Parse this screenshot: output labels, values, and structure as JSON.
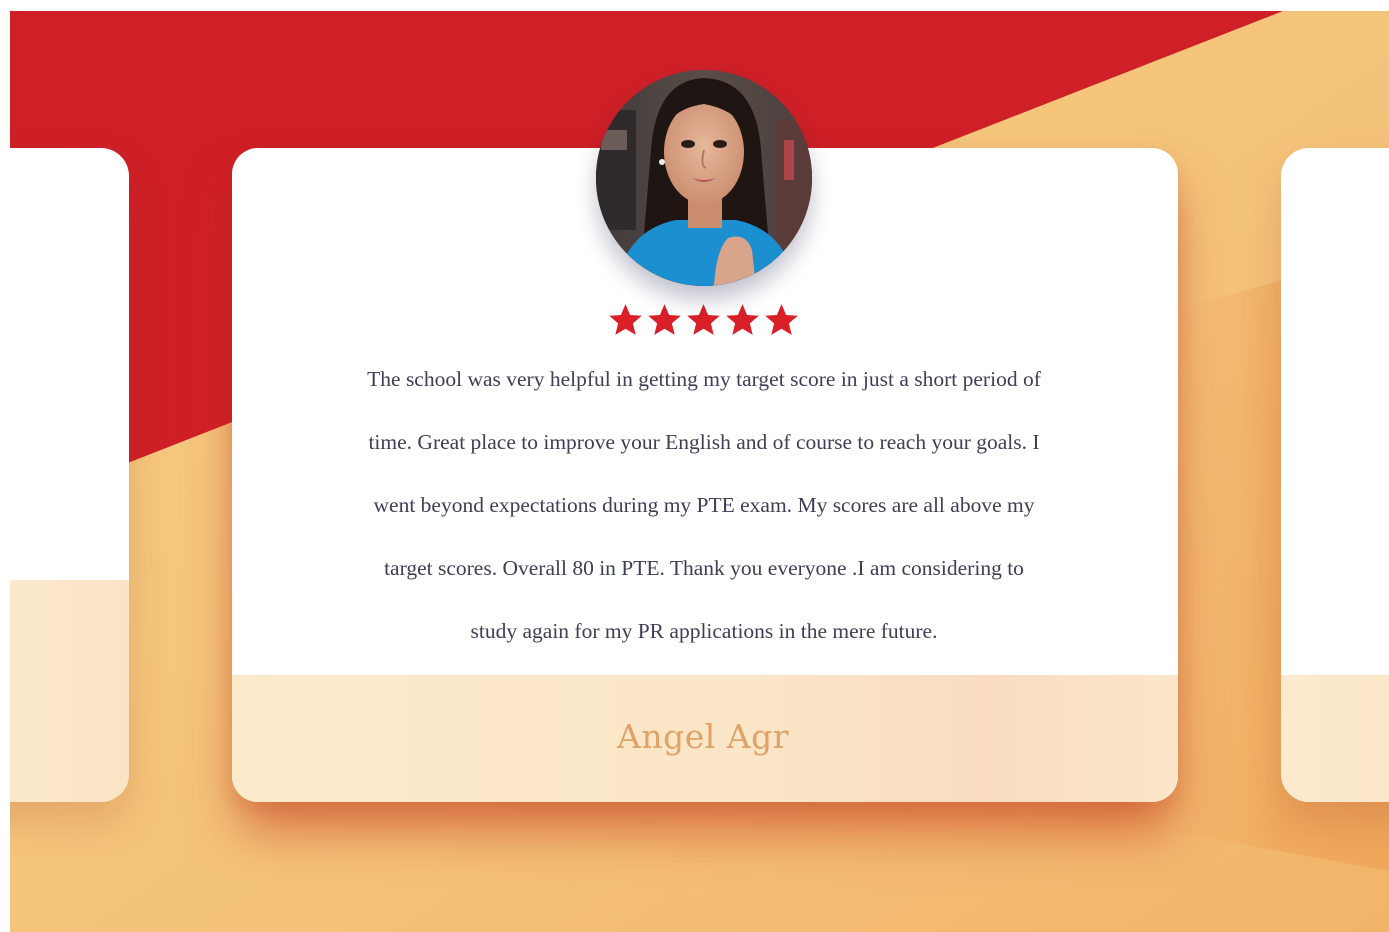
{
  "testimonial": {
    "rating": 5,
    "rating_max": 5,
    "review_text": "The school was very helpful in getting my target score in just a short period of\ntime. Great place to improve your English and of course to reach your goals.  I\nwent beyond expectations  during my PTE exam. My scores  are all above my\ntarget scores.  Overall 80 in PTE.  Thank you everyone .I am considering to\nstudy again for my PR applications in the mere future.",
    "author": "Angel Agr"
  },
  "icons": {
    "star": "star-icon",
    "avatar": "profile-photo"
  },
  "colors": {
    "brand_red": "#cf2027",
    "background_gold": "#f5c97e",
    "star_red": "#d92028",
    "author_gold": "#e0a266",
    "text_dark": "#3d3f55"
  }
}
